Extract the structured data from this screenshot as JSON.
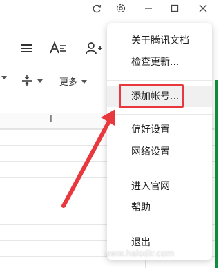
{
  "menu": {
    "items": [
      {
        "label": "关于腾讯文档"
      },
      {
        "label": "检查更新..."
      },
      {
        "label": "添加帐号..."
      },
      {
        "label": "偏好设置"
      },
      {
        "label": "网络设置"
      },
      {
        "label": "进入官网"
      },
      {
        "label": "帮助"
      },
      {
        "label": "退出"
      }
    ]
  },
  "toolbar": {
    "more_label": "更多"
  },
  "grid": {
    "col_header_mark": "I"
  },
  "watermark": "www.halodir.com",
  "colors": {
    "highlight": "#e8383d",
    "green_edge": "#0d8f3c"
  },
  "icons": [
    "refresh-icon",
    "gear-icon",
    "minimize-icon",
    "maximize-icon",
    "close-icon",
    "menu-icon",
    "font-icon",
    "add-user-icon",
    "split-icon",
    "dropdown-arrow-icon"
  ]
}
